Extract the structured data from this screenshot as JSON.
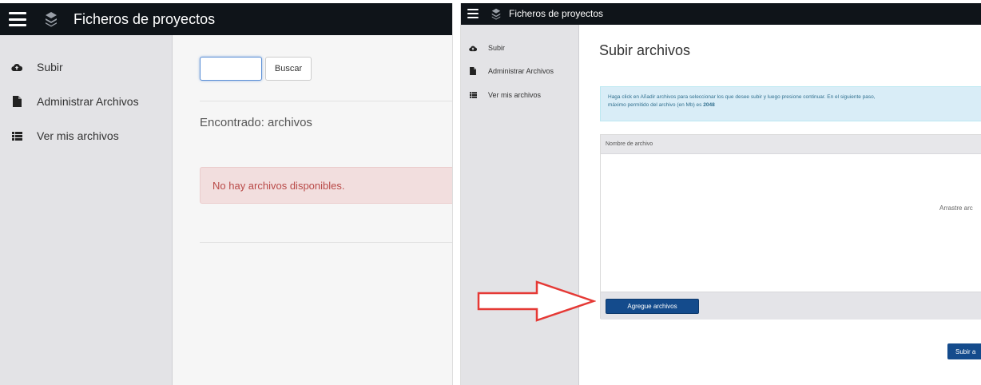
{
  "left_screen": {
    "topbar": {
      "title": "Ficheros de proyectos",
      "menu_icon": "hamburger-icon",
      "logo_icon": "stack-logo-icon"
    },
    "sidebar": {
      "items": [
        {
          "label": "Subir",
          "icon": "cloud-upload-icon"
        },
        {
          "label": "Administrar Archivos",
          "icon": "file-icon"
        },
        {
          "label": "Ver mis archivos",
          "icon": "list-icon"
        }
      ]
    },
    "main": {
      "search_value": "",
      "search_button": "Buscar",
      "found_text": "Encontrado: archivos",
      "empty_alert": "No hay archivos disponibles."
    }
  },
  "right_screen": {
    "topbar": {
      "title": "Ficheros de proyectos",
      "menu_icon": "hamburger-icon",
      "logo_icon": "stack-logo-icon"
    },
    "sidebar": {
      "items": [
        {
          "label": "Subir",
          "icon": "cloud-upload-icon"
        },
        {
          "label": "Administrar Archivos",
          "icon": "file-icon"
        },
        {
          "label": "Ver mis archivos",
          "icon": "list-icon"
        }
      ]
    },
    "main": {
      "page_title": "Subir archivos",
      "info_line1": "Haga click en Añadir archivos para seleccionar los que desee subir y luego presione continuar. En el siguiente paso,",
      "info_line2_prefix": "máximo permitido del archivo (en Mb) es ",
      "info_max_mb": "2048",
      "table_header": "Nombre de archivo",
      "drag_text": "Arrastre arc",
      "add_files_button": "Agregue archivos",
      "submit_button": "Subir a"
    }
  },
  "annotation": {
    "arrow_color": "#e53935",
    "points_to": "Agregue archivos"
  },
  "colors": {
    "topbar": "#0f1419",
    "sidebar": "#e3e3e6",
    "primary_button": "#144b8c",
    "alert_danger_bg": "#f2dede",
    "alert_danger_text": "#b94a48",
    "alert_info_bg": "#d9edf7",
    "alert_info_text": "#31708f"
  }
}
